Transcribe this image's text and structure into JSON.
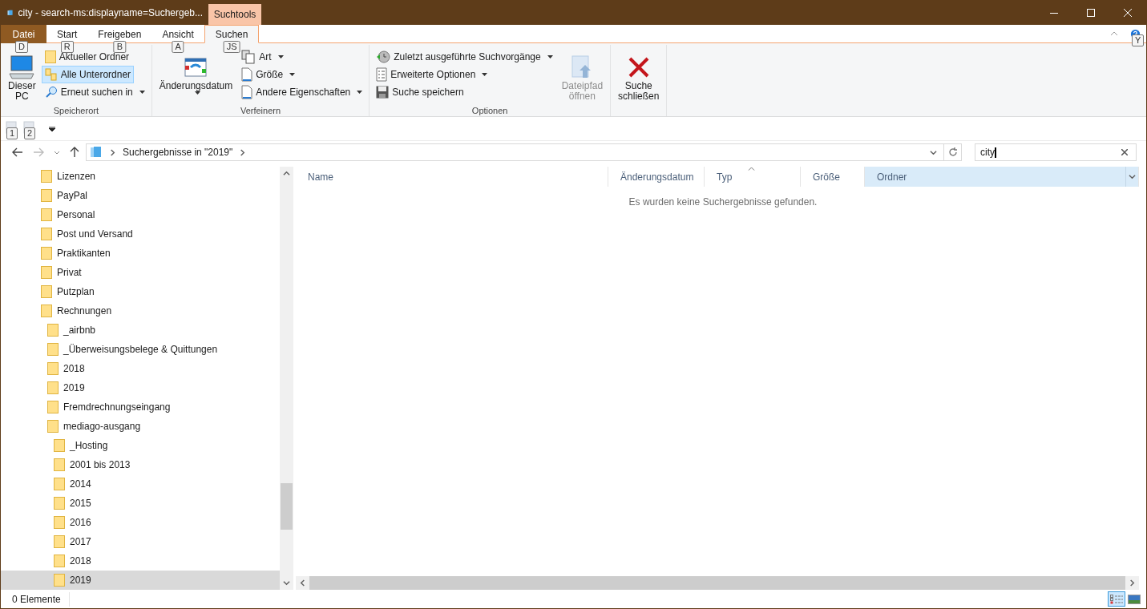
{
  "window": {
    "title": "city - search-ms:displayname=Suchergeb...",
    "context_tab": "Suchtools"
  },
  "ribbon_tabs": [
    {
      "label": "Datei",
      "kind": "file",
      "keytip": "D",
      "selected": false
    },
    {
      "label": "Start",
      "kind": "tab",
      "keytip": "R",
      "selected": false
    },
    {
      "label": "Freigeben",
      "kind": "tab",
      "keytip": "B",
      "selected": false
    },
    {
      "label": "Ansicht",
      "kind": "tab",
      "keytip": "A",
      "selected": false
    },
    {
      "label": "Suchen",
      "kind": "tab",
      "keytip": "JS",
      "selected": true
    }
  ],
  "help_keytip": "Y",
  "ribbon_groups": [
    {
      "label": "Speicherort",
      "items": [
        {
          "label": "Dieser PC",
          "kind": "large",
          "dropdown": false,
          "selected": false,
          "disabled": false
        },
        {
          "label": "Aktueller Ordner",
          "kind": "small",
          "dropdown": false,
          "selected": false,
          "disabled": false
        },
        {
          "label": "Alle Unterordner",
          "kind": "small",
          "dropdown": false,
          "selected": true,
          "disabled": false
        },
        {
          "label": "Erneut suchen in",
          "kind": "small",
          "dropdown": true,
          "selected": false,
          "disabled": false
        }
      ]
    },
    {
      "label": "Verfeinern",
      "items": [
        {
          "label": "Änderungsdatum",
          "kind": "large",
          "dropdown": true,
          "selected": false,
          "disabled": false
        },
        {
          "label": "Art",
          "kind": "small",
          "dropdown": true,
          "selected": false,
          "disabled": false
        },
        {
          "label": "Größe",
          "kind": "small",
          "dropdown": true,
          "selected": false,
          "disabled": false
        },
        {
          "label": "Andere Eigenschaften",
          "kind": "small",
          "dropdown": true,
          "selected": false,
          "disabled": false
        }
      ]
    },
    {
      "label": "Optionen",
      "items": [
        {
          "label": "Zuletzt ausgeführte Suchvorgänge",
          "kind": "small",
          "dropdown": true,
          "selected": false,
          "disabled": false
        },
        {
          "label": "Erweiterte Optionen",
          "kind": "small",
          "dropdown": true,
          "selected": false,
          "disabled": false
        },
        {
          "label": "Suche speichern",
          "kind": "small",
          "dropdown": false,
          "selected": false,
          "disabled": false
        },
        {
          "label": "Dateipfad öffnen",
          "kind": "large",
          "dropdown": false,
          "selected": false,
          "disabled": true
        }
      ]
    },
    {
      "items": [
        {
          "label": "Suche schließen",
          "kind": "large",
          "dropdown": false,
          "selected": false,
          "disabled": false
        }
      ]
    }
  ],
  "quick_access": {
    "keytips": [
      "1",
      "2"
    ]
  },
  "address_bar": {
    "path": "Suchergebnisse in \"2019\""
  },
  "search": {
    "value": "city"
  },
  "navigation": [
    {
      "label": "Lizenzen",
      "selected": false
    },
    {
      "label": "PayPal",
      "selected": false
    },
    {
      "label": "Personal",
      "selected": false
    },
    {
      "label": "Post und Versand",
      "selected": false
    },
    {
      "label": "Praktikanten",
      "selected": false
    },
    {
      "label": "Privat",
      "selected": false
    },
    {
      "label": "Putzplan",
      "selected": false
    },
    {
      "label": "Rechnungen",
      "selected": false,
      "children": [
        {
          "label": "_airbnb",
          "selected": false
        },
        {
          "label": "_Überweisungsbelege & Quittungen",
          "selected": false
        },
        {
          "label": "2018",
          "selected": false
        },
        {
          "label": "2019",
          "selected": false
        },
        {
          "label": "Fremdrechnungseingang",
          "selected": false
        },
        {
          "label": "mediago-ausgang",
          "selected": false,
          "children": [
            {
              "label": "_Hosting",
              "selected": false
            },
            {
              "label": "2001 bis 2013",
              "selected": false
            },
            {
              "label": "2014",
              "selected": false
            },
            {
              "label": "2015",
              "selected": false
            },
            {
              "label": "2016",
              "selected": false
            },
            {
              "label": "2017",
              "selected": false
            },
            {
              "label": "2018",
              "selected": false
            },
            {
              "label": "2019",
              "selected": true
            }
          ]
        }
      ]
    }
  ],
  "table": {
    "columns": [
      {
        "label": "Name",
        "sorted": false,
        "selected": false
      },
      {
        "label": "Änderungsdatum",
        "sorted": false,
        "selected": false
      },
      {
        "label": "Typ",
        "sorted": true,
        "selected": false
      },
      {
        "label": "Größe",
        "sorted": false,
        "selected": false
      },
      {
        "label": "Ordner",
        "sorted": false,
        "selected": true
      }
    ],
    "empty_message": "Es wurden keine Suchergebnisse gefunden."
  },
  "status_bar": {
    "count": "0 Elemente",
    "views": [
      {
        "kind": "details",
        "selected": true
      },
      {
        "kind": "large-icons",
        "selected": false
      }
    ]
  }
}
